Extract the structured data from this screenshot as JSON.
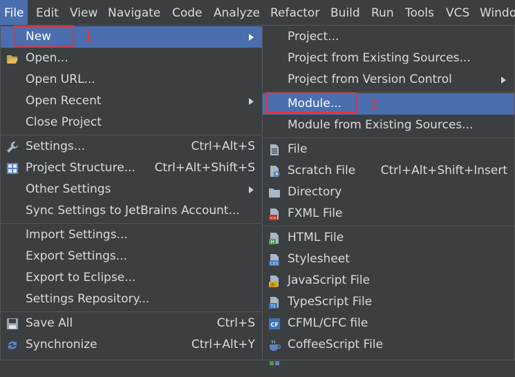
{
  "menubar": {
    "items": [
      {
        "label": "File"
      },
      {
        "label": "Edit"
      },
      {
        "label": "View"
      },
      {
        "label": "Navigate"
      },
      {
        "label": "Code"
      },
      {
        "label": "Analyze"
      },
      {
        "label": "Refactor"
      },
      {
        "label": "Build"
      },
      {
        "label": "Run"
      },
      {
        "label": "Tools"
      },
      {
        "label": "VCS"
      },
      {
        "label": "Windo"
      }
    ]
  },
  "file_menu": {
    "new": "New",
    "open": "Open...",
    "open_url": "Open URL...",
    "open_recent": "Open Recent",
    "close_project": "Close Project",
    "settings": "Settings...",
    "settings_sc": "Ctrl+Alt+S",
    "project_structure": "Project Structure...",
    "project_structure_sc": "Ctrl+Alt+Shift+S",
    "other_settings": "Other Settings",
    "sync_settings": "Sync Settings to JetBrains Account...",
    "import_settings": "Import Settings...",
    "export_settings": "Export Settings...",
    "export_eclipse": "Export to Eclipse...",
    "settings_repo": "Settings Repository...",
    "save_all": "Save All",
    "save_all_sc": "Ctrl+S",
    "synchronize": "Synchronize",
    "synchronize_sc": "Ctrl+Alt+Y"
  },
  "new_menu": {
    "project": "Project...",
    "project_existing": "Project from Existing Sources...",
    "project_vcs": "Project from Version Control",
    "module": "Module...",
    "module_existing": "Module from Existing Sources...",
    "file": "File",
    "scratch": "Scratch File",
    "scratch_sc": "Ctrl+Alt+Shift+Insert",
    "directory": "Directory",
    "fxml": "FXML File",
    "html": "HTML File",
    "stylesheet": "Stylesheet",
    "javascript": "JavaScript File",
    "typescript": "TypeScript File",
    "cfml": "CFML/CFC file",
    "coffeescript": "CoffeeScript File"
  },
  "annotations": {
    "one": "1",
    "two": "2"
  },
  "colors": {
    "accent": "#4b6eaf",
    "highlight_box": "#e0353b",
    "background": "#3c3f41"
  }
}
